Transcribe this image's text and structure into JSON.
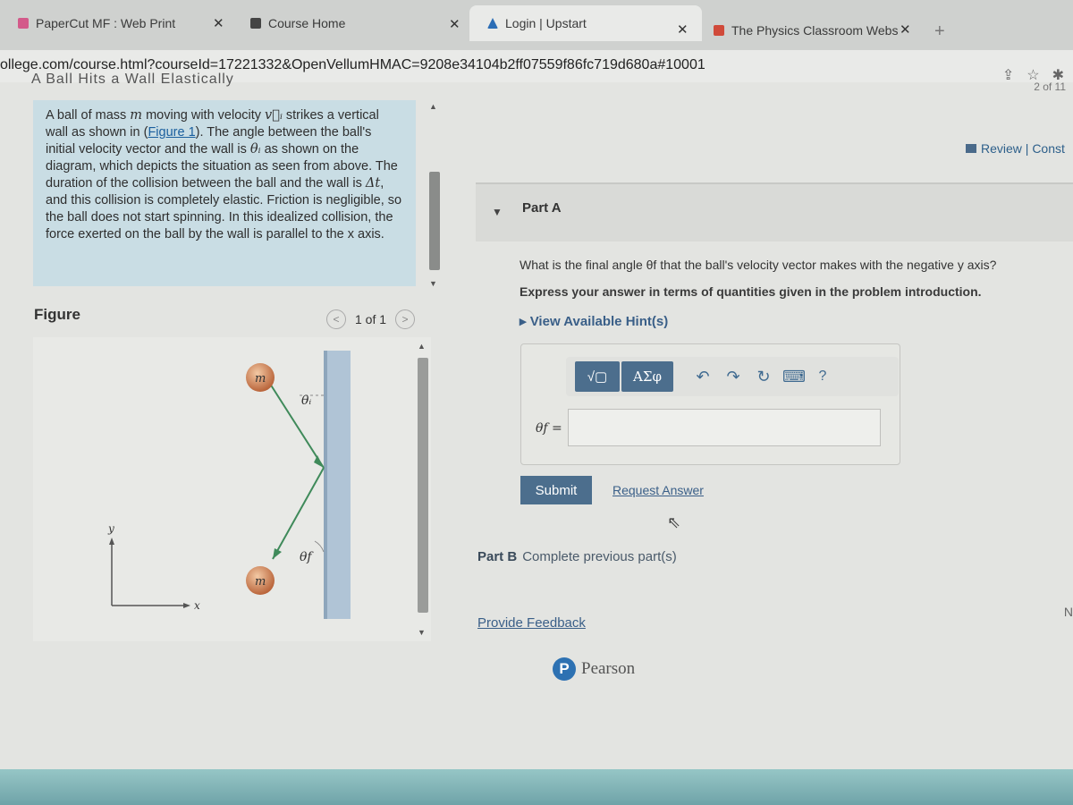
{
  "browser": {
    "tabs": [
      {
        "title": "PaperCut MF : Web Print",
        "icon": "papercut-icon",
        "color": "#d35a8a"
      },
      {
        "title": "Course Home",
        "icon": "page-icon",
        "color": "#444444"
      },
      {
        "title": "Login | Upstart",
        "icon": "upstart-icon",
        "color": "#2b6db5",
        "active": true
      },
      {
        "title": "The Physics Classroom Webs",
        "icon": "physics-classroom-icon",
        "color": "#d04a3a"
      }
    ],
    "close_glyph": "✕",
    "new_tab_glyph": "+",
    "url": "ollege.com/course.html?courseId=17221332&OpenVellumHMAC=9208e34104b2ff07559f86fc719d680a#10001",
    "address_icons": [
      "share-icon",
      "star-icon",
      "extensions-icon"
    ]
  },
  "page": {
    "cut_title": "A Ball Hits a Wall Elastically",
    "pager_top": "2 of 11",
    "intro": {
      "p1": "A ball of mass ",
      "m": "m",
      "p2": " moving with velocity ",
      "vi": "v⃗ᵢ",
      "p3": " strikes a vertical wall as shown in (",
      "figure_link": "Figure 1",
      "p4": "). The angle between the ball's initial velocity vector and the wall is ",
      "thetai": "θᵢ",
      "p5": " as shown on the diagram, which depicts the situation as seen from above. The duration of the collision between the ball and the wall is ",
      "dt": "Δt",
      "p6": ", and this collision is completely elastic. Friction is negligible, so the ball does not start spinning. In this idealized collision, the force exerted on the ball by the wall is parallel to the x axis."
    },
    "figure": {
      "label": "Figure",
      "pager": "1 of 1",
      "prev_glyph": "<",
      "next_glyph": ">",
      "mass_label": "m",
      "theta_i": "θᵢ",
      "theta_f": "θf",
      "axis_x": "x",
      "axis_y": "y"
    },
    "review": "Review | Const",
    "part_a": {
      "title": "Part A",
      "question": "What is the final angle θf that the ball's velocity vector makes with the negative y axis?",
      "express": "Express your answer in terms of quantities given in the problem introduction.",
      "hints": "▸ View Available Hint(s)",
      "toolbar": {
        "sqrt_label": "√▢",
        "greek_label": "ΑΣφ",
        "undo": "↶",
        "redo": "↷",
        "reset": "↻",
        "keyboard": "⌨",
        "help": "?"
      },
      "answer_label": "θf =",
      "answer_value": "",
      "submit": "Submit",
      "request_answer": "Request Answer"
    },
    "part_b": {
      "label": "Part B",
      "text": "Complete previous part(s)"
    },
    "feedback": "Provide Feedback",
    "pearson": "Pearson",
    "pearson_logo": "P",
    "edge_text": "N"
  }
}
